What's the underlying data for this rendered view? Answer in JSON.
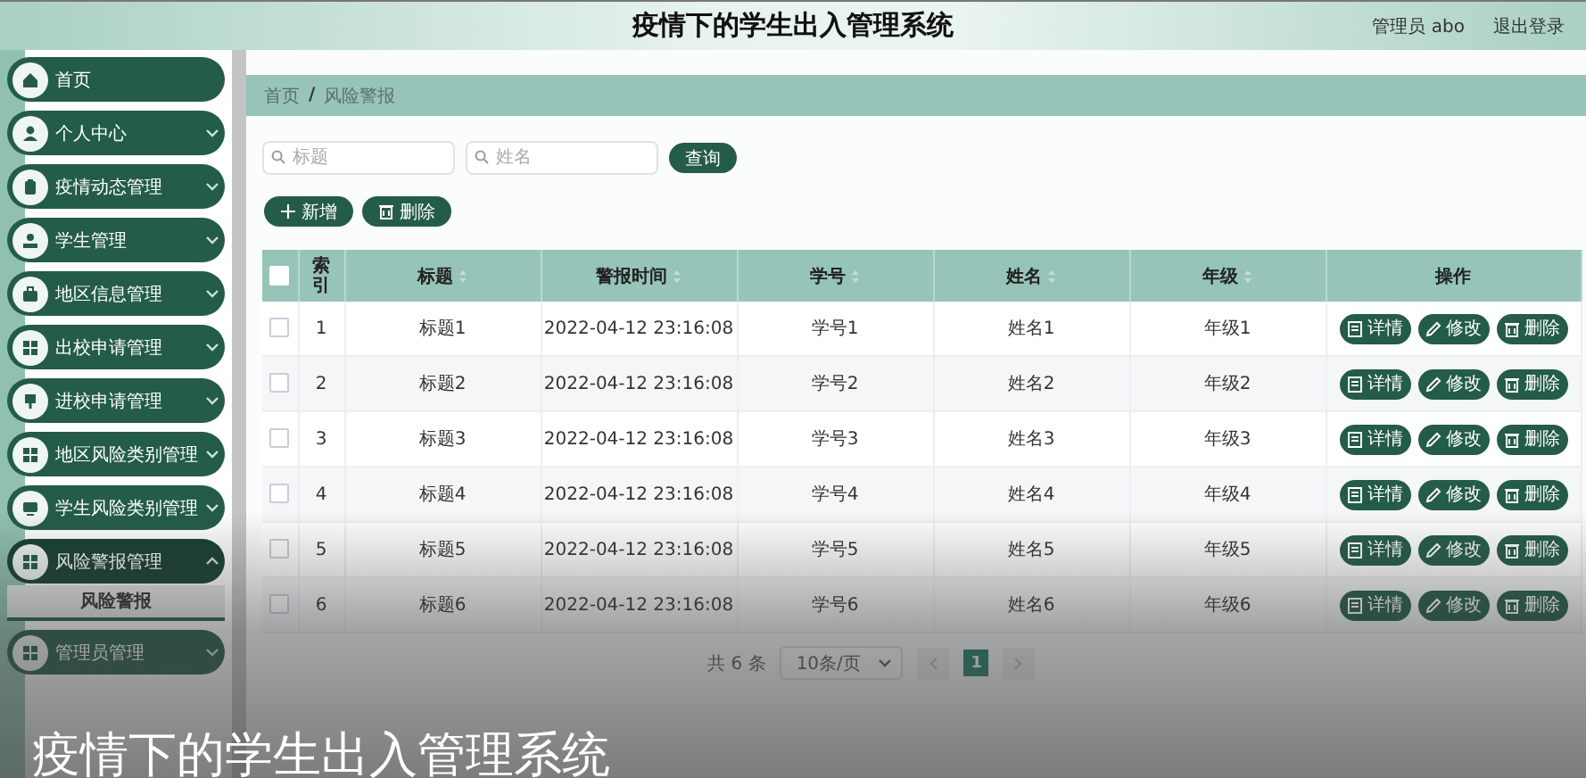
{
  "header": {
    "title": "疫情下的学生出入管理系统",
    "user": "管理员 abo",
    "logout": "退出登录"
  },
  "sidebar": {
    "items": [
      {
        "label": "首页",
        "expandable": false,
        "expanded": false
      },
      {
        "label": "个人中心",
        "expandable": true,
        "expanded": false
      },
      {
        "label": "疫情动态管理",
        "expandable": true,
        "expanded": false
      },
      {
        "label": "学生管理",
        "expandable": true,
        "expanded": false
      },
      {
        "label": "地区信息管理",
        "expandable": true,
        "expanded": false
      },
      {
        "label": "出校申请管理",
        "expandable": true,
        "expanded": false
      },
      {
        "label": "进校申请管理",
        "expandable": true,
        "expanded": false
      },
      {
        "label": "地区风险类别管理",
        "expandable": true,
        "expanded": false
      },
      {
        "label": "学生风险类别管理",
        "expandable": true,
        "expanded": false
      },
      {
        "label": "风险警报管理",
        "expandable": true,
        "expanded": true,
        "children": [
          {
            "label": "风险警报",
            "selected": true
          }
        ]
      },
      {
        "label": "管理员管理",
        "expandable": true,
        "expanded": false
      }
    ]
  },
  "breadcrumb": {
    "items": [
      "首页",
      "风险警报"
    ],
    "separator": "/"
  },
  "search": {
    "fields": [
      {
        "placeholder": "标题"
      },
      {
        "placeholder": "姓名"
      }
    ],
    "button": "查询"
  },
  "actions": [
    {
      "label": "新增",
      "kind": "add"
    },
    {
      "label": "删除",
      "kind": "delete"
    }
  ],
  "table": {
    "select_all": false,
    "columns": [
      {
        "label": "索引",
        "sortable": false
      },
      {
        "label": "标题",
        "sortable": true
      },
      {
        "label": "警报时间",
        "sortable": true
      },
      {
        "label": "学号",
        "sortable": true
      },
      {
        "label": "姓名",
        "sortable": true
      },
      {
        "label": "年级",
        "sortable": true
      },
      {
        "label": "操作",
        "sortable": false
      }
    ],
    "rows": [
      {
        "checked": false,
        "cells": [
          "1",
          "标题1",
          "2022-04-12 23:16:08",
          "学号1",
          "姓名1",
          "年级1"
        ],
        "actions": [
          {
            "label": "详情",
            "kind": "detail"
          },
          {
            "label": "修改",
            "kind": "edit"
          },
          {
            "label": "删除",
            "kind": "delete"
          }
        ]
      },
      {
        "checked": false,
        "cells": [
          "2",
          "标题2",
          "2022-04-12 23:16:08",
          "学号2",
          "姓名2",
          "年级2"
        ],
        "actions": [
          {
            "label": "详情",
            "kind": "detail"
          },
          {
            "label": "修改",
            "kind": "edit"
          },
          {
            "label": "删除",
            "kind": "delete"
          }
        ]
      },
      {
        "checked": false,
        "cells": [
          "3",
          "标题3",
          "2022-04-12 23:16:08",
          "学号3",
          "姓名3",
          "年级3"
        ],
        "actions": [
          {
            "label": "详情",
            "kind": "detail"
          },
          {
            "label": "修改",
            "kind": "edit"
          },
          {
            "label": "删除",
            "kind": "delete"
          }
        ]
      },
      {
        "checked": false,
        "cells": [
          "4",
          "标题4",
          "2022-04-12 23:16:08",
          "学号4",
          "姓名4",
          "年级4"
        ],
        "actions": [
          {
            "label": "详情",
            "kind": "detail"
          },
          {
            "label": "修改",
            "kind": "edit"
          },
          {
            "label": "删除",
            "kind": "delete"
          }
        ]
      },
      {
        "checked": false,
        "cells": [
          "5",
          "标题5",
          "2022-04-12 23:16:08",
          "学号5",
          "姓名5",
          "年级5"
        ],
        "actions": [
          {
            "label": "详情",
            "kind": "detail"
          },
          {
            "label": "修改",
            "kind": "edit"
          },
          {
            "label": "删除",
            "kind": "delete"
          }
        ]
      },
      {
        "checked": false,
        "cells": [
          "6",
          "标题6",
          "2022-04-12 23:16:08",
          "学号6",
          "姓名6",
          "年级6"
        ],
        "actions": [
          {
            "label": "详情",
            "kind": "detail"
          },
          {
            "label": "修改",
            "kind": "edit"
          },
          {
            "label": "删除",
            "kind": "delete"
          }
        ]
      }
    ]
  },
  "pagination": {
    "total": "共 6 条",
    "page_size": "10条/页",
    "pages": [
      {
        "label": "1",
        "selected": true
      }
    ]
  },
  "caption": "疫情下的学生出入管理系统"
}
